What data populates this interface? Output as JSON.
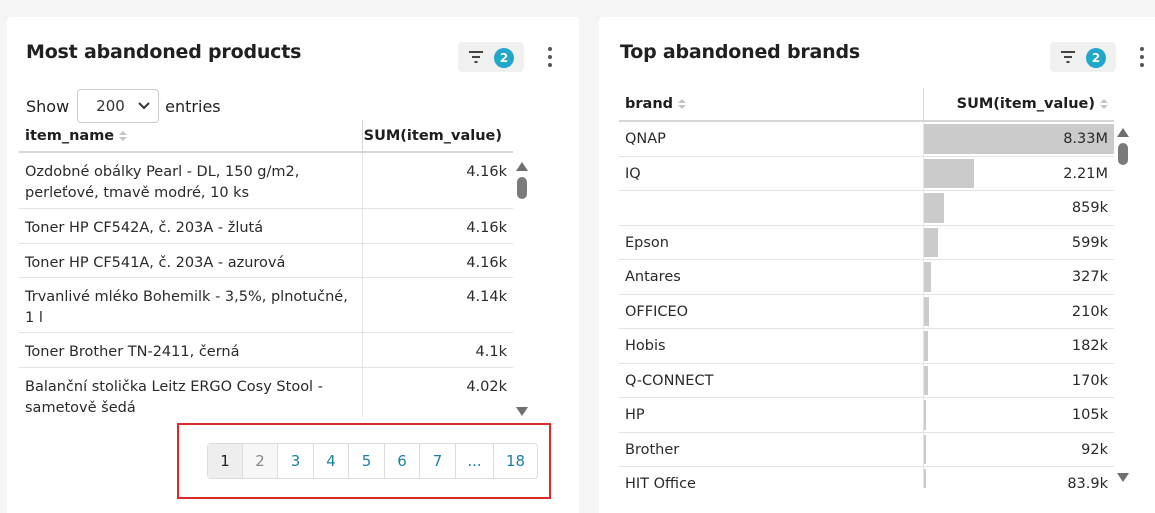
{
  "products_card": {
    "title": "Most abandoned products",
    "filter_count": "2",
    "show_label": "Show",
    "entries_value": "200",
    "entries_label": "entries",
    "columns": [
      "item_name",
      "SUM(item_value)"
    ],
    "rows": [
      {
        "name": "Ozdobné obálky Pearl - DL, 150 g/m2, perleťové, tmavě modré, 10 ks",
        "value": "4.16k"
      },
      {
        "name": "Toner HP CF542A, č. 203A - žlutá",
        "value": "4.16k"
      },
      {
        "name": "Toner HP CF541A, č. 203A - azurová",
        "value": "4.16k"
      },
      {
        "name": "Trvanlivé mléko Bohemilk - 3,5%, plnotučné, 1 l",
        "value": "4.14k"
      },
      {
        "name": "Toner Brother TN-2411, černá",
        "value": "4.1k"
      },
      {
        "name": "Balanční stolička Leitz ERGO Cosy Stool - sametově šedá",
        "value": "4.02k"
      }
    ],
    "pagination": [
      "1",
      "2",
      "3",
      "4",
      "5",
      "6",
      "7",
      "...",
      "18"
    ]
  },
  "brands_card": {
    "title": "Top abandoned brands",
    "filter_count": "2",
    "columns": [
      "brand",
      "SUM(item_value)"
    ],
    "rows": [
      {
        "brand": "QNAP",
        "value": "8.33M",
        "fraction": 1.0
      },
      {
        "brand": "IQ",
        "value": "2.21M",
        "fraction": 0.265
      },
      {
        "brand": "",
        "value": "859k",
        "fraction": 0.103
      },
      {
        "brand": "Epson",
        "value": "599k",
        "fraction": 0.072
      },
      {
        "brand": "Antares",
        "value": "327k",
        "fraction": 0.039
      },
      {
        "brand": "OFFICEO",
        "value": "210k",
        "fraction": 0.025
      },
      {
        "brand": "Hobis",
        "value": "182k",
        "fraction": 0.022
      },
      {
        "brand": "Q-CONNECT",
        "value": "170k",
        "fraction": 0.02
      },
      {
        "brand": "HP",
        "value": "105k",
        "fraction": 0.013
      },
      {
        "brand": "Brother",
        "value": "92k",
        "fraction": 0.011
      },
      {
        "brand": "HIT Office",
        "value": "83.9k",
        "fraction": 0.01
      }
    ]
  },
  "colors": {
    "accent": "#20a7c9",
    "link": "#1e7fa3",
    "bar": "#cbcbcb",
    "highlight": "#d92b2b"
  }
}
